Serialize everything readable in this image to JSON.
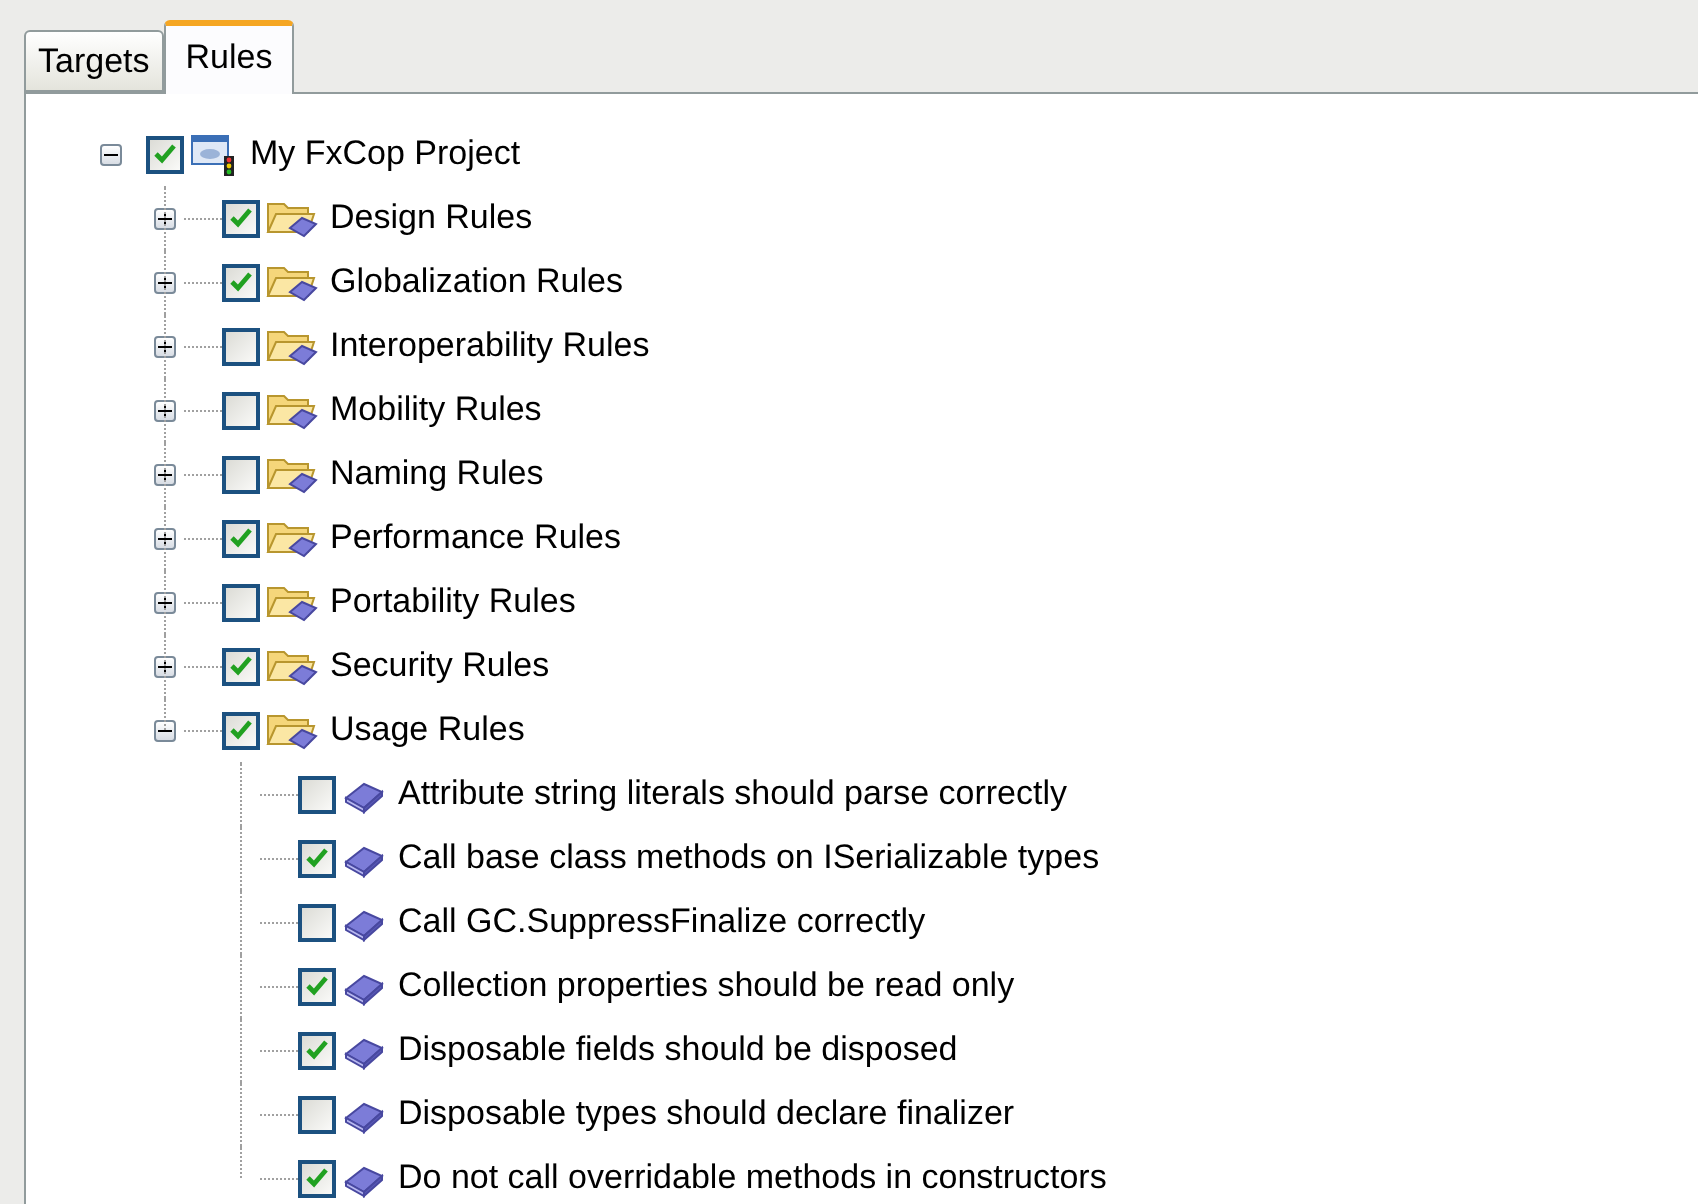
{
  "tabs": [
    {
      "label": "Targets",
      "selected": false
    },
    {
      "label": "Rules",
      "selected": true
    }
  ],
  "tree": [
    {
      "kind": "project",
      "label": "My FxCop Project",
      "checked": true,
      "expanded": true,
      "children": [
        {
          "kind": "folder",
          "label": "Design Rules",
          "checked": true,
          "expanded": false
        },
        {
          "kind": "folder",
          "label": "Globalization Rules",
          "checked": true,
          "expanded": false
        },
        {
          "kind": "folder",
          "label": "Interoperability Rules",
          "checked": false,
          "expanded": false
        },
        {
          "kind": "folder",
          "label": "Mobility Rules",
          "checked": false,
          "expanded": false
        },
        {
          "kind": "folder",
          "label": "Naming Rules",
          "checked": false,
          "expanded": false
        },
        {
          "kind": "folder",
          "label": "Performance Rules",
          "checked": true,
          "expanded": false
        },
        {
          "kind": "folder",
          "label": "Portability Rules",
          "checked": false,
          "expanded": false
        },
        {
          "kind": "folder",
          "label": "Security Rules",
          "checked": true,
          "expanded": false
        },
        {
          "kind": "folder",
          "label": "Usage Rules",
          "checked": true,
          "expanded": true,
          "children": [
            {
              "kind": "rule",
              "label": "Attribute string literals should parse correctly",
              "checked": false
            },
            {
              "kind": "rule",
              "label": "Call base class methods on ISerializable types",
              "checked": true
            },
            {
              "kind": "rule",
              "label": "Call GC.SuppressFinalize correctly",
              "checked": false
            },
            {
              "kind": "rule",
              "label": "Collection properties should be read only",
              "checked": true
            },
            {
              "kind": "rule",
              "label": "Disposable fields should be disposed",
              "checked": true
            },
            {
              "kind": "rule",
              "label": "Disposable types should declare finalizer",
              "checked": false
            },
            {
              "kind": "rule",
              "label": "Do not call overridable methods in constructors",
              "checked": true
            }
          ]
        }
      ]
    }
  ]
}
